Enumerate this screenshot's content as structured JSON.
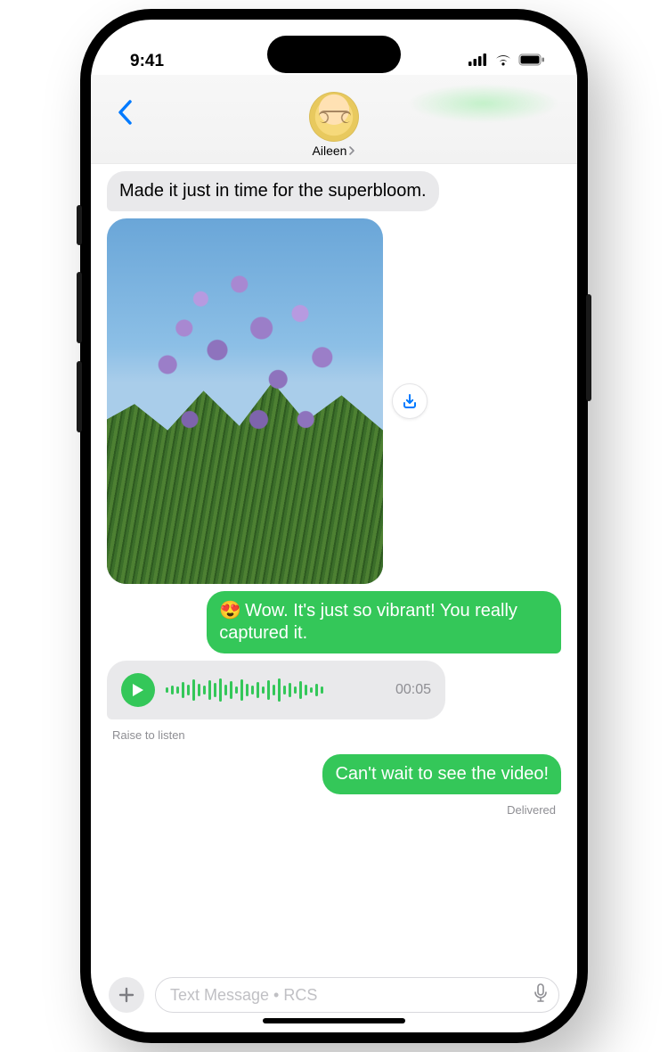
{
  "status_bar": {
    "time": "9:41"
  },
  "header": {
    "contact_name": "Aileen"
  },
  "messages": {
    "incoming_text_1": "Made it just in time for the superbloom.",
    "image_alt": "Photo of purple superbloom flowers",
    "outgoing_text_1_emoji": "😍",
    "outgoing_text_1": "Wow. It's just so vibrant! You really captured it.",
    "audio_duration": "00:05",
    "audio_hint": "Raise to listen",
    "outgoing_text_2": "Can't wait to see the video!",
    "delivery_status": "Delivered"
  },
  "compose": {
    "placeholder": "Text Message • RCS"
  },
  "colors": {
    "sms_green": "#34c759",
    "ios_blue": "#007aff"
  }
}
